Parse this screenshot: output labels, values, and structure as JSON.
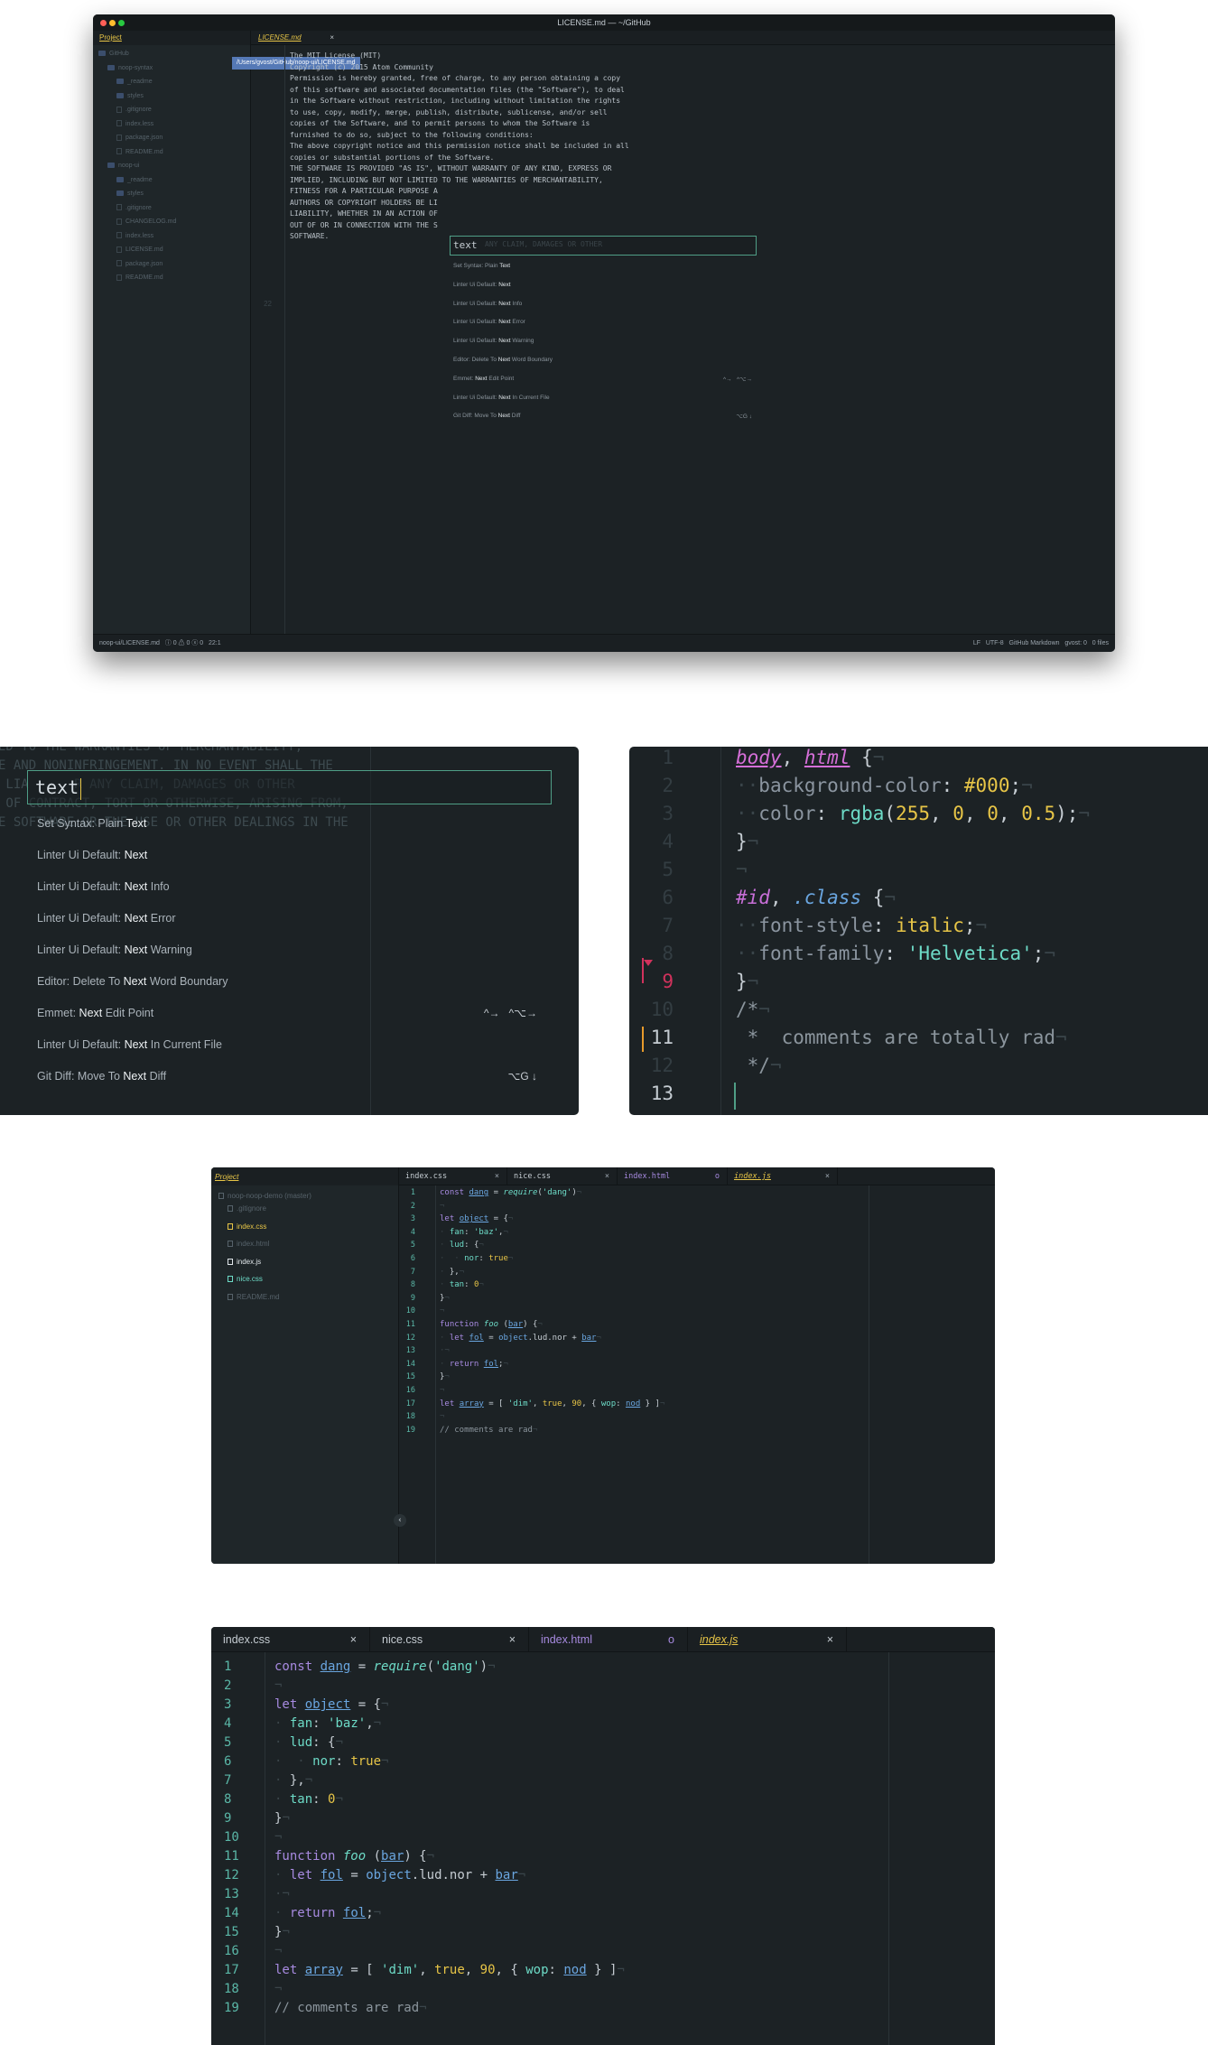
{
  "colors": {
    "background": "#1c2225",
    "accent": "#e7c547",
    "teal": "#6ddbc7",
    "border": "#4f9e86",
    "tooltip": "#5579b6"
  },
  "shot1": {
    "window_title": "LICENSE.md — ~/GitHub",
    "tree_header": "Project",
    "tree": [
      {
        "label": "GitHub",
        "type": "folder",
        "depth": 0
      },
      {
        "label": "noop-syntax",
        "type": "folder",
        "depth": 1
      },
      {
        "label": "_readme",
        "type": "folder",
        "depth": 2
      },
      {
        "label": "styles",
        "type": "folder",
        "depth": 2
      },
      {
        "label": ".gitignore",
        "type": "file",
        "depth": 2
      },
      {
        "label": "index.less",
        "type": "file",
        "depth": 2
      },
      {
        "label": "package.json",
        "type": "file",
        "depth": 2
      },
      {
        "label": "README.md",
        "type": "file",
        "depth": 2
      },
      {
        "label": "noop-ui",
        "type": "folder",
        "depth": 1
      },
      {
        "label": "_readme",
        "type": "folder",
        "depth": 2
      },
      {
        "label": "styles",
        "type": "folder",
        "depth": 2
      },
      {
        "label": ".gitignore",
        "type": "file",
        "depth": 2
      },
      {
        "label": "CHANGELOG.md",
        "type": "file",
        "depth": 2
      },
      {
        "label": "index.less",
        "type": "file",
        "depth": 2
      },
      {
        "label": "LICENSE.md",
        "type": "file",
        "depth": 2
      },
      {
        "label": "package.json",
        "type": "file",
        "depth": 2
      },
      {
        "label": "README.md",
        "type": "file",
        "depth": 2
      }
    ],
    "tab_label": "LICENSE.md",
    "tab_close": "×",
    "tooltip": "/Users/gvost/GitHub/noop-ui/LICENSE.md",
    "line_number": "22",
    "code": [
      "The MIT License (MIT)",
      "",
      "Copyright (c) 2015 Atom Community",
      "",
      "Permission is hereby granted, free of charge, to any person obtaining a copy",
      "of this software and associated documentation files (the \"Software\"), to deal",
      "in the Software without restriction, including without limitation the rights",
      "to use, copy, modify, merge, publish, distribute, sublicense, and/or sell",
      "copies of the Software, and to permit persons to whom the Software is",
      "furnished to do so, subject to the following conditions:",
      "",
      "The above copyright notice and this permission notice shall be included in all",
      "copies or substantial portions of the Software.",
      "",
      "THE SOFTWARE IS PROVIDED \"AS IS\", WITHOUT WARRANTY OF ANY KIND, EXPRESS OR",
      "IMPLIED, INCLUDING BUT NOT LIMITED TO THE WARRANTIES OF MERCHANTABILITY,",
      "FITNESS FOR A PARTICULAR PURPOSE A",
      "AUTHORS OR COPYRIGHT HOLDERS BE LI",
      "LIABILITY, WHETHER IN AN ACTION OF",
      "OUT OF OR IN CONNECTION WITH THE S",
      "SOFTWARE."
    ],
    "palette_query": "text",
    "palette_ghost": "ANY CLAIM, DAMAGES OR OTHER",
    "status_left": "noop-ui/LICENSE.md   ⓘ 0 ⚠ 0 ⓧ 0   22:1",
    "status_right": "LF   UTF-8   GitHub Markdown   gvost: 0   0 files"
  },
  "palette": {
    "query": "text",
    "items": [
      {
        "pre": "Set Syntax: Plain ",
        "hl": "Text",
        "post": "",
        "keys": ""
      },
      {
        "pre": "Linter Ui Default: ",
        "hl": "Next",
        "post": "",
        "keys": ""
      },
      {
        "pre": "Linter Ui Default: ",
        "hl": "Next",
        "post": " Info",
        "keys": ""
      },
      {
        "pre": "Linter Ui Default: ",
        "hl": "Next",
        "post": " Error",
        "keys": ""
      },
      {
        "pre": "Linter Ui Default: ",
        "hl": "Next",
        "post": " Warning",
        "keys": ""
      },
      {
        "pre": "Editor: Delete To ",
        "hl": "Next",
        "post": " Word Boundary",
        "keys": ""
      },
      {
        "pre": "Emmet: ",
        "hl": "Next",
        "post": " Edit Point",
        "keys": "^→   ^⌥→"
      },
      {
        "pre": "Linter Ui Default: ",
        "hl": "Next",
        "post": " In Current File",
        "keys": ""
      },
      {
        "pre": "Git Diff: Move To ",
        "hl": "Next",
        "post": " Diff",
        "keys": "⌥G ↓"
      }
    ]
  },
  "shot2": {
    "ghost_lines": [
      "ED TO THE WARRANTIES OF MERCHANTABILITY,",
      "E AND NONINFRINGEMENT. IN NO EVENT SHALL THE",
      " LIA      R ANY CLAIM, DAMAGES OR OTHER",
      " OF CONTRACT, TORT OR OTHERWISE, ARISING FROM,",
      "E SOFTWARE OR THE USE OR OTHER DEALINGS IN THE"
    ]
  },
  "shot3": {
    "line_numbers": [
      "1",
      "2",
      "3",
      "4",
      "5",
      "6",
      "7",
      "8",
      "9",
      "10",
      "11",
      "12",
      "13"
    ]
  },
  "shot4": {
    "tree_header": "Project",
    "root": "noop-noop-demo (master)",
    "files": [
      {
        "label": ".gitignore",
        "color": "#56626a"
      },
      {
        "label": "index.css",
        "color": "#e7c547"
      },
      {
        "label": "index.html",
        "color": "#56626a"
      },
      {
        "label": "index.js",
        "color": "#e0e6ea"
      },
      {
        "label": "nice.css",
        "color": "#6ddbc7"
      },
      {
        "label": "README.md",
        "color": "#56626a"
      }
    ],
    "collapse_icon": "‹"
  },
  "tabs": [
    {
      "label": "index.css",
      "close": "×",
      "color": "#c5ccd2"
    },
    {
      "label": "nice.css",
      "close": "×",
      "color": "#c5ccd2"
    },
    {
      "label": "index.html",
      "close": "o",
      "color": "#a78ae0"
    },
    {
      "label": "index.js",
      "close": "×",
      "color": "#e7c547"
    }
  ],
  "js_line_numbers": [
    "1",
    "2",
    "3",
    "4",
    "5",
    "6",
    "7",
    "8",
    "9",
    "10",
    "11",
    "12",
    "13",
    "14",
    "15",
    "16",
    "17",
    "18",
    "19"
  ]
}
